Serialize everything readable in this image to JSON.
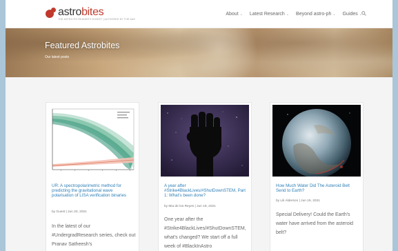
{
  "site": {
    "logo_prefix": "astro",
    "logo_accent": "bites",
    "tagline": "THE ASTRO-PH READER'S DIGEST | AUTHORED BY THE AAS"
  },
  "nav": {
    "items": [
      {
        "label": "About"
      },
      {
        "label": "Latest Research"
      },
      {
        "label": "Beyond astro-ph"
      },
      {
        "label": "Guides"
      }
    ]
  },
  "hero": {
    "title": "Featured Astrobites",
    "subtitle": "Our latest posts"
  },
  "cards": [
    {
      "title": "UR: A spectropolarimetric method for predicting the gravitational wave polarisation of LISA verification binaries",
      "meta": "by Guest | Jun 20, 2021",
      "excerpt": "In the latest of our #UndergradResearch series, check out Pranav Satheesh's"
    },
    {
      "title": "A year after #Strike4BlackLives/#ShutDownSTEM, Part 1: What's been done?",
      "meta": "by Mia de los Reyes | Jun 19, 2021",
      "excerpt": "One year after the #Strike4BlackLives/#ShutDownSTEM, what's changed? We start off a full week of #BlackInAstro"
    },
    {
      "title": "How Much Water Did The Asteroid Belt Send to Earth?",
      "meta": "by Lili Alderson | Jun 19, 2021",
      "excerpt": "Special Delivery! Could the Earth's water have arrived from the asteroid belt?"
    }
  ],
  "colors": {
    "accent": "#c0392b",
    "link": "#2e7fb6"
  }
}
